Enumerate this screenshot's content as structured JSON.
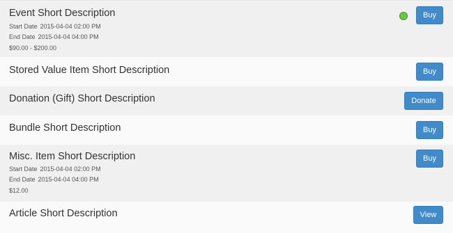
{
  "items": [
    {
      "title": "Event Short Description",
      "start_label": "Start Date",
      "start_value": "2015-04-04 02:00 PM",
      "end_label": "End Date",
      "end_value": "2015-04-04 04:00 PM",
      "price": "$90.00 - $200.00",
      "button_label": "Buy",
      "status_color": "#6cc644"
    },
    {
      "title": "Stored Value Item Short Description",
      "button_label": "Buy"
    },
    {
      "title": "Donation (Gift) Short Description",
      "button_label": "Donate"
    },
    {
      "title": "Bundle Short Description",
      "button_label": "Buy"
    },
    {
      "title": "Misc. Item Short Description",
      "start_label": "Start Date",
      "start_value": "2015-04-04 02:00 PM",
      "end_label": "End Date",
      "end_value": "2015-04-04 04:00 PM",
      "price": "$12.00",
      "button_label": "Buy"
    },
    {
      "title": "Article Short Description",
      "button_label": "View"
    }
  ],
  "colors": {
    "button": "#428bca",
    "row_alt": "#f0f0f0",
    "row": "#fafafa",
    "status_available": "#6cc644"
  }
}
